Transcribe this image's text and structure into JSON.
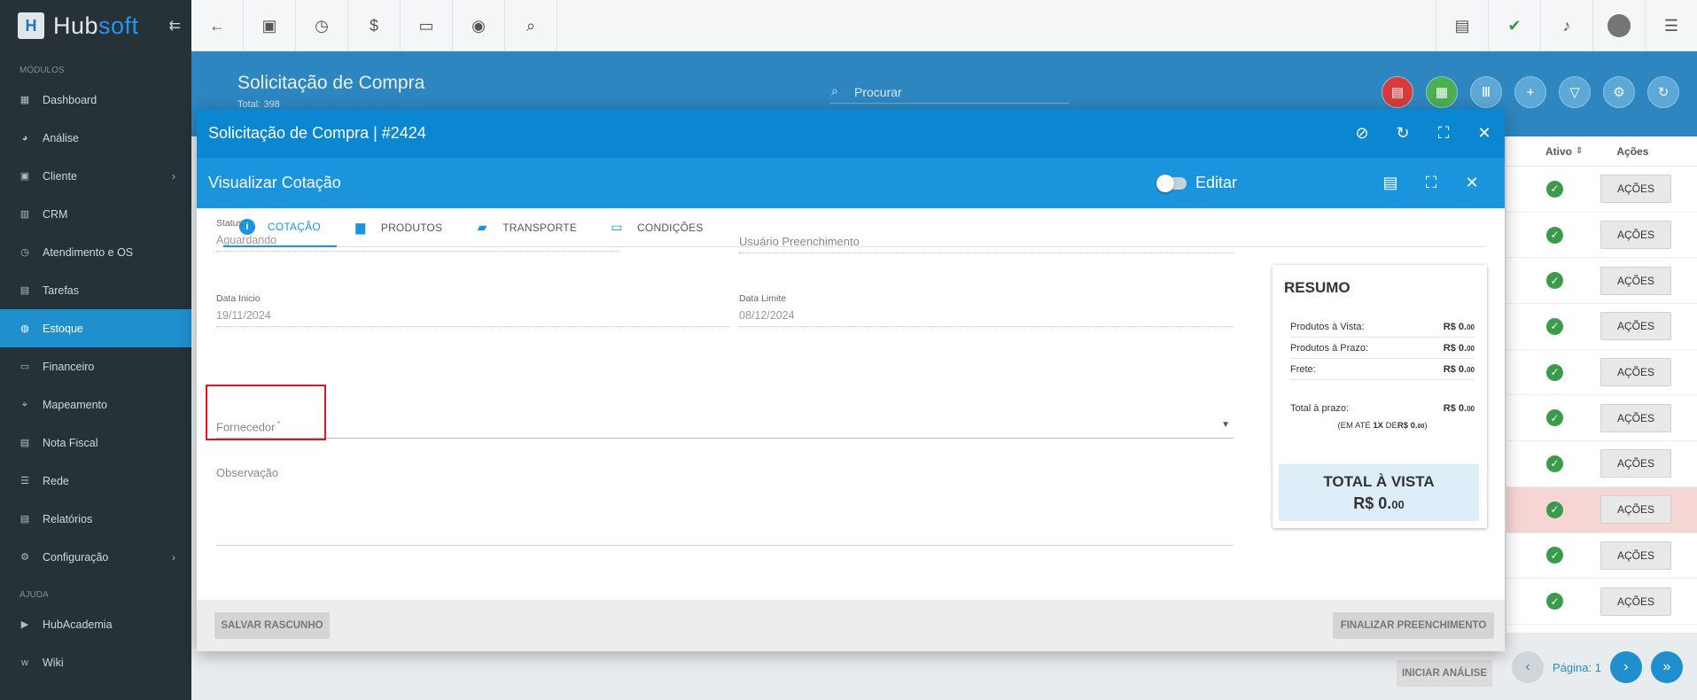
{
  "sidebar": {
    "brand": {
      "prefix": "Hub",
      "suffix": "soft"
    },
    "section_modules": "MÓDULOS",
    "section_help": "AJUDA",
    "items": [
      {
        "label": "Dashboard",
        "icon": "dashboard-icon"
      },
      {
        "label": "Análise",
        "icon": "pie-chart-icon"
      },
      {
        "label": "Cliente",
        "icon": "user-card-icon"
      },
      {
        "label": "CRM",
        "icon": "board-icon"
      },
      {
        "label": "Atendimento e OS",
        "icon": "clock-calendar-icon"
      },
      {
        "label": "Tarefas",
        "icon": "tasks-icon"
      },
      {
        "label": "Estoque",
        "icon": "box-icon"
      },
      {
        "label": "Financeiro",
        "icon": "money-icon"
      },
      {
        "label": "Mapeamento",
        "icon": "map-pin-icon"
      },
      {
        "label": "Nota Fiscal",
        "icon": "invoice-icon"
      },
      {
        "label": "Rede",
        "icon": "server-icon"
      },
      {
        "label": "Relatórios",
        "icon": "report-icon"
      },
      {
        "label": "Configuração",
        "icon": "gear-icon"
      }
    ],
    "help_items": [
      {
        "label": "HubAcademia",
        "icon": "video-icon"
      },
      {
        "label": "Wiki",
        "icon": "wiki-icon"
      }
    ]
  },
  "page": {
    "title": "Solicitação de Compra",
    "total": "Total: 398",
    "search_placeholder": "Procurar"
  },
  "bg_table": {
    "col_ativo": "Ativo",
    "col_acoes": "Ações",
    "action_label": "AÇÕES",
    "rows": 10
  },
  "pager": {
    "label": "Página: 1",
    "iniciar": "INICIAR ANÁLISE"
  },
  "modal": {
    "title": "Solicitação de Compra | #2424",
    "inner_title": "Visualizar Cotação",
    "edit_toggle_label": "Editar",
    "tabs": [
      {
        "label": "COTAÇÃO",
        "icon": "info-icon"
      },
      {
        "label": "PRODUTOS",
        "icon": "package-icon"
      },
      {
        "label": "TRANSPORTE",
        "icon": "truck-icon"
      },
      {
        "label": "CONDIÇÕES",
        "icon": "cash-icon"
      }
    ],
    "form": {
      "status_label": "Status",
      "status_value": "Aguardando",
      "usuario_placeholder": "Usuário Preenchimento",
      "data_inicio_label": "Data Inicio",
      "data_inicio_value": "19/11/2024",
      "data_limite_label": "Data Limite",
      "data_limite_value": "08/12/2024",
      "fornecedor_placeholder": "Fornecedor",
      "observacao_placeholder": "Observação"
    },
    "resumo": {
      "title": "RESUMO",
      "vista_label": "Produtos à Vista:",
      "vista_value": "R$ 0.",
      "prazo_label": "Produtos à Prazo:",
      "prazo_value": "R$ 0.",
      "frete_label": "Frete:",
      "frete_value": "R$ 0.",
      "total_prazo_label": "Total à prazo:",
      "total_prazo_value": "R$ 0.",
      "cents": "00",
      "parcelas_prefix": "(EM ATÉ ",
      "parcelas_count": "1X",
      "parcelas_mid": " DE",
      "parcelas_value": "R$ 0.",
      "total_vista_title": "TOTAL À VISTA",
      "total_vista_value": "R$ 0."
    },
    "footer": {
      "salvar": "SALVAR RASCUNHO",
      "finalizar": "FINALIZAR PREENCHIMENTO"
    }
  }
}
